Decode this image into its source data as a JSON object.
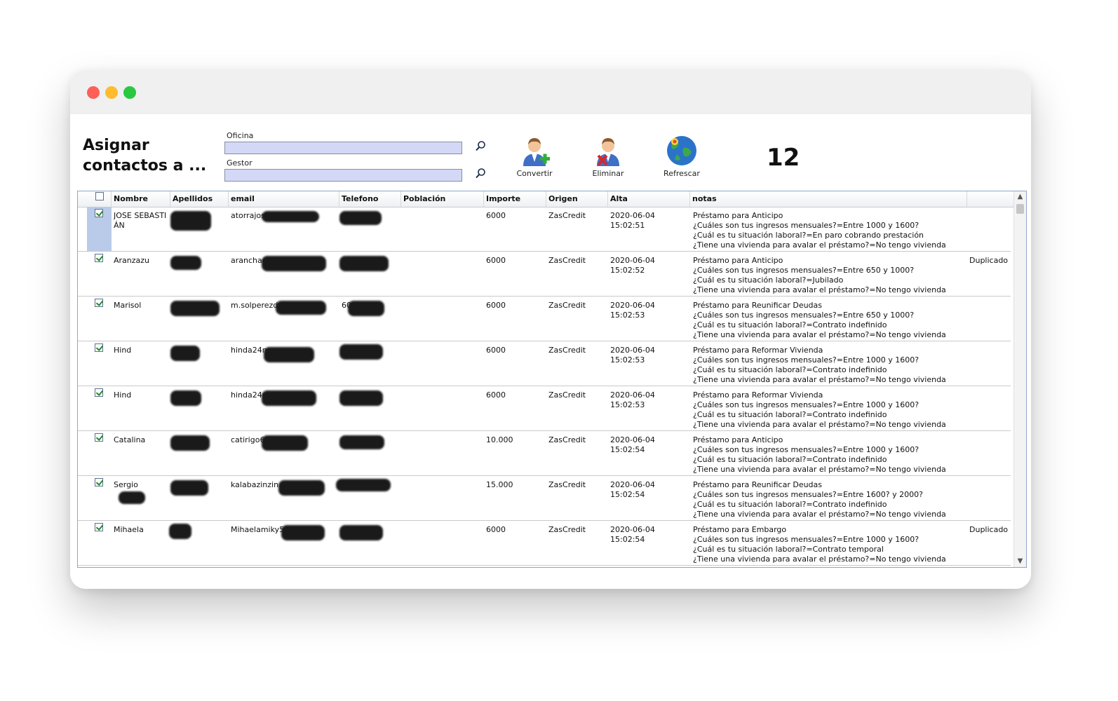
{
  "window": {
    "controls": [
      "close",
      "minimize",
      "zoom"
    ]
  },
  "page": {
    "title": "Asignar contactos a ...",
    "counter": "12"
  },
  "filters": {
    "oficina_label": "Oficina",
    "oficina_value": "",
    "gestor_label": "Gestor",
    "gestor_value": ""
  },
  "toolbar": {
    "convertir_label": "Convertir",
    "eliminar_label": "Eliminar",
    "refrescar_label": "Refrescar"
  },
  "table": {
    "headers": {
      "nombre": "Nombre",
      "apellidos": "Apellidos",
      "email": "email",
      "telefono": "Telefono",
      "poblacion": "Población",
      "importe": "Importe",
      "origen": "Origen",
      "alta": "Alta",
      "notas": "notas"
    },
    "rows": [
      {
        "checked": true,
        "nombre": "JOSE SEBASTIÁN",
        "apellidos": "AGA",
        "email": "atorrajos",
        "telefono": "",
        "poblacion": "",
        "importe": "6000",
        "origen": "ZasCredit",
        "alta_date": "2020-06-04",
        "alta_time": "15:02:51",
        "notas": [
          "Préstamo para Anticipo",
          "¿Cuáles son tus ingresos mensuales?=Entre 1000 y 1600?",
          "¿Cuál es tu situación laboral?=En paro cobrando prestación",
          "¿Tiene una vivienda para avalar el préstamo?=No tengo vivienda"
        ],
        "estado": ""
      },
      {
        "checked": true,
        "nombre": "Aranzazu",
        "apellidos": "G",
        "email": "aranchag",
        "telefono": "",
        "poblacion": "",
        "importe": "6000",
        "origen": "ZasCredit",
        "alta_date": "2020-06-04",
        "alta_time": "15:02:52",
        "notas": [
          "Préstamo para Anticipo",
          "¿Cuáles son tus ingresos mensuales?=Entre 650 y 1000?",
          "¿Cuál es tu situación laboral?=Jubilado",
          "¿Tiene una vivienda para avalar el préstamo?=No tengo vivienda"
        ],
        "estado": "Duplicado"
      },
      {
        "checked": true,
        "nombre": "Marisol",
        "apellidos": "",
        "email": "m.solperezd",
        "telefono": "60",
        "poblacion": "",
        "importe": "6000",
        "origen": "ZasCredit",
        "alta_date": "2020-06-04",
        "alta_time": "15:02:53",
        "notas": [
          "Préstamo para Reunificar Deudas",
          "¿Cuáles son tus ingresos mensuales?=Entre 650 y 1000?",
          "¿Cuál es tu situación laboral?=Contrato indefinido",
          "¿Tiene una vivienda para avalar el préstamo?=No tengo vivienda"
        ],
        "estado": ""
      },
      {
        "checked": true,
        "nombre": "Hind",
        "apellidos": "",
        "email": "hinda24m",
        "telefono": "",
        "poblacion": "",
        "importe": "6000",
        "origen": "ZasCredit",
        "alta_date": "2020-06-04",
        "alta_time": "15:02:53",
        "notas": [
          "Préstamo para Reformar Vivienda",
          "¿Cuáles son tus ingresos mensuales?=Entre 1000 y 1600?",
          "¿Cuál es tu situación laboral?=Contrato indefinido",
          "¿Tiene una vivienda para avalar el préstamo?=No tengo vivienda"
        ],
        "estado": ""
      },
      {
        "checked": true,
        "nombre": "Hind",
        "apellidos": "",
        "email": "hinda24m",
        "telefono": "",
        "poblacion": "",
        "importe": "6000",
        "origen": "ZasCredit",
        "alta_date": "2020-06-04",
        "alta_time": "15:02:53",
        "notas": [
          "Préstamo para Reformar Vivienda",
          "¿Cuáles son tus ingresos mensuales?=Entre 1000 y 1600?",
          "¿Cuál es tu situación laboral?=Contrato indefinido",
          "¿Tiene una vivienda para avalar el préstamo?=No tengo vivienda"
        ],
        "estado": ""
      },
      {
        "checked": true,
        "nombre": "Catalina",
        "apellidos": "",
        "email": "catirigo6",
        "telefono": "",
        "poblacion": "",
        "importe": "10.000",
        "origen": "ZasCredit",
        "alta_date": "2020-06-04",
        "alta_time": "15:02:54",
        "notas": [
          "Préstamo para Anticipo",
          "¿Cuáles son tus ingresos mensuales?=Entre 1000 y 1600?",
          "¿Cuál es tu situación laboral?=Contrato indefinido",
          "¿Tiene una vivienda para avalar el préstamo?=No tengo vivienda"
        ],
        "estado": ""
      },
      {
        "checked": true,
        "nombre": "Sergio",
        "apellidos": "",
        "email": "kalabazinzin",
        "telefono": "",
        "poblacion": "",
        "importe": "15.000",
        "origen": "ZasCredit",
        "alta_date": "2020-06-04",
        "alta_time": "15:02:54",
        "notas": [
          "Préstamo para Reunificar Deudas",
          "¿Cuáles son tus ingresos mensuales?=Entre 1600? y 2000?",
          "¿Cuál es tu situación laboral?=Contrato indefinido",
          "¿Tiene una vivienda para avalar el préstamo?=No tengo vivienda"
        ],
        "estado": ""
      },
      {
        "checked": true,
        "nombre": "Mihaela",
        "apellidos": "",
        "email": "Mihaelamiky58",
        "telefono": "",
        "poblacion": "",
        "importe": "6000",
        "origen": "ZasCredit",
        "alta_date": "2020-06-04",
        "alta_time": "15:02:54",
        "notas": [
          "Préstamo para Embargo",
          "¿Cuáles son tus ingresos mensuales?=Entre 1000 y 1600?",
          "¿Cuál es tu situación laboral?=Contrato temporal",
          "¿Tiene una vivienda para avalar el préstamo?=No tengo vivienda"
        ],
        "estado": "Duplicado"
      }
    ]
  },
  "icons": {
    "search": "magnifier-icon",
    "convertir": "user-add-icon",
    "eliminar": "user-delete-icon",
    "refrescar": "globe-refresh-icon"
  },
  "colors": {
    "input_bg": "#d4d8f7",
    "selected_row": "#b9cbe8",
    "check_green": "#1f8a2a"
  }
}
